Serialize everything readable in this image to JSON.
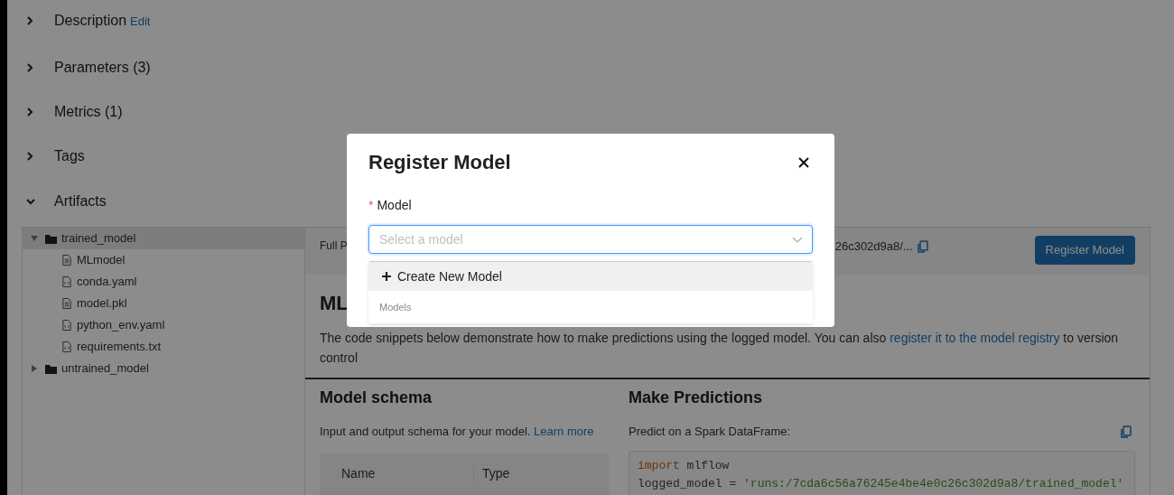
{
  "sections": [
    {
      "label": "Description",
      "expanded": false,
      "action": "Edit"
    },
    {
      "label": "Parameters (3)",
      "expanded": false
    },
    {
      "label": "Metrics (1)",
      "expanded": false
    },
    {
      "label": "Tags",
      "expanded": false
    },
    {
      "label": "Artifacts",
      "expanded": true
    }
  ],
  "artifact_tree": [
    {
      "name": "trained_model",
      "kind": "folder",
      "expanded": true,
      "selected": true,
      "children": [
        {
          "name": "MLmodel",
          "kind": "file",
          "selected": false
        },
        {
          "name": "conda.yaml",
          "kind": "code_file",
          "selected": false
        },
        {
          "name": "model.pkl",
          "kind": "file",
          "selected": false
        },
        {
          "name": "python_env.yaml",
          "kind": "code_file",
          "selected": false
        },
        {
          "name": "requirements.txt",
          "kind": "code_file",
          "selected": false
        }
      ]
    },
    {
      "name": "untrained_model",
      "kind": "folder",
      "expanded": false,
      "selected": false
    }
  ],
  "detail": {
    "path_label": "Full P",
    "path_end": "26c302d9a8/...",
    "register_button": "Register Model",
    "heading": "ML",
    "description": "The code snippets below demonstrate how to make predictions using the logged model. You can also ",
    "description_link": "register it to the model registry",
    "description_end": " to version control"
  },
  "model_schema": {
    "title": "Model schema",
    "text": "Input and output schema for your model. ",
    "link": "Learn more",
    "columns": [
      "Name",
      "Type"
    ]
  },
  "predictions": {
    "title": "Make Predictions",
    "subtitle": "Predict on a Spark DataFrame:",
    "code": [
      [
        {
          "kind": "keyword",
          "text": "import"
        },
        {
          "kind": "plain",
          "text": " mlflow"
        }
      ],
      [
        {
          "kind": "plain",
          "text": "logged_model = "
        },
        {
          "kind": "string",
          "text": "'runs:/7cda6c56a76245e4be4e0c26c302d9a8/trained_model'"
        }
      ]
    ]
  },
  "modal": {
    "title": "Register Model",
    "field_label": "Model",
    "required_mark": "*",
    "placeholder": "Select a model",
    "options": [
      {
        "kind": "create",
        "label": "Create New Model",
        "highlighted": true
      },
      {
        "kind": "group",
        "label": "Models"
      }
    ]
  }
}
